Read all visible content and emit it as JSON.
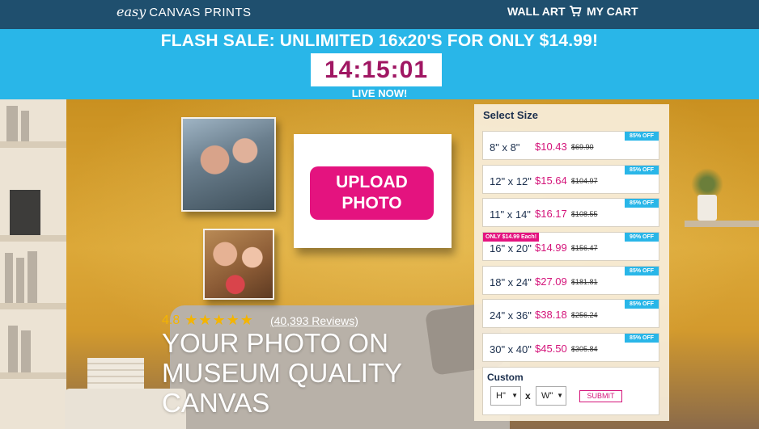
{
  "nav": {
    "logo_easy": "easy",
    "logo_brand": "CANVAS PRINTS",
    "wall_art": "WALL ART",
    "cart": "MY CART",
    "cart_icon": "cart-icon"
  },
  "banner": {
    "title": "FLASH SALE: UNLIMITED 16x20'S FOR ONLY $14.99!",
    "timer": "14:15:01",
    "live": "LIVE NOW!"
  },
  "hero": {
    "upload_button_line1": "UPLOAD",
    "upload_button_line2": "PHOTO",
    "rating_score": "4.8",
    "stars": "★★★★★",
    "reviews": "(40,393 Reviews)",
    "headline": [
      "YOUR PHOTO ON",
      "MUSEUM QUALITY",
      "CANVAS"
    ]
  },
  "size_panel": {
    "title": "Select Size",
    "sizes": [
      {
        "dim": "8\" x 8\"",
        "price": "$10.43",
        "old": "$69.90",
        "badge": "85% OFF",
        "promo": ""
      },
      {
        "dim": "12\" x 12\"",
        "price": "$15.64",
        "old": "$104.97",
        "badge": "85% OFF",
        "promo": ""
      },
      {
        "dim": "11\" x 14\"",
        "price": "$16.17",
        "old": "$108.55",
        "badge": "85% OFF",
        "promo": ""
      },
      {
        "dim": "16\" x 20\"",
        "price": "$14.99",
        "old": "$156.47",
        "badge": "90% OFF",
        "promo": "ONLY $14.99 Each!"
      },
      {
        "dim": "18\" x 24\"",
        "price": "$27.09",
        "old": "$181.81",
        "badge": "85% OFF",
        "promo": ""
      },
      {
        "dim": "24\" x 36\"",
        "price": "$38.18",
        "old": "$256.24",
        "badge": "85% OFF",
        "promo": ""
      },
      {
        "dim": "30\" x 40\"",
        "price": "$45.50",
        "old": "$305.84",
        "badge": "85% OFF",
        "promo": ""
      }
    ],
    "custom": {
      "title": "Custom",
      "height_value": "H\"",
      "width_value": "W\"",
      "x": "x",
      "submit": "SUBMIT"
    }
  },
  "colors": {
    "nav_bg": "#1f4f6e",
    "banner_bg": "#29b6e8",
    "accent_pink": "#e4137f",
    "timer_text": "#a01763"
  }
}
